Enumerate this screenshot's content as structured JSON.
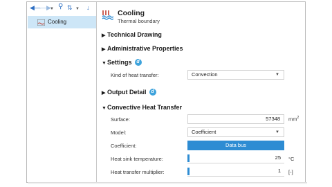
{
  "toolbar": {
    "icons": [
      "back-arrow-icon",
      "forward-arrow-icon",
      "dropdown-icon",
      "search-icon",
      "sort-icon",
      "dropdown-icon",
      "download-icon"
    ]
  },
  "tree": {
    "items": [
      {
        "label": "Cooling",
        "icon": "thermal-boundary-icon",
        "selected": true
      }
    ]
  },
  "header": {
    "title": "Cooling",
    "subtitle": "Thermal boundary",
    "icon": "thermal-boundary-icon"
  },
  "sections": {
    "technical_drawing": "Technical Drawing",
    "administrative": "Administrative Properties",
    "settings": "Settings",
    "output_detail": "Output Detail",
    "convective": "Convective Heat Transfer"
  },
  "settings": {
    "kind_label": "Kind of heat transfer:",
    "kind_value": "Convection"
  },
  "convective": {
    "surface_label": "Surface:",
    "surface_value": "57348",
    "surface_unit": "mm",
    "surface_unit_exp": "2",
    "model_label": "Model:",
    "model_value": "Coefficient",
    "coefficient_label": "Coefficient:",
    "coefficient_value": "Data bus",
    "sink_label": "Heat sink temperature:",
    "sink_value": "25",
    "sink_unit": "°C",
    "multiplier_label": "Heat transfer multiplier:",
    "multiplier_value": "1",
    "multiplier_unit": "[-]"
  },
  "colors": {
    "accent": "#2e8cd3",
    "selection": "#cde6f7",
    "info_badge": "#3ea3dc",
    "toolbar_icon": "#2e6fc3"
  }
}
